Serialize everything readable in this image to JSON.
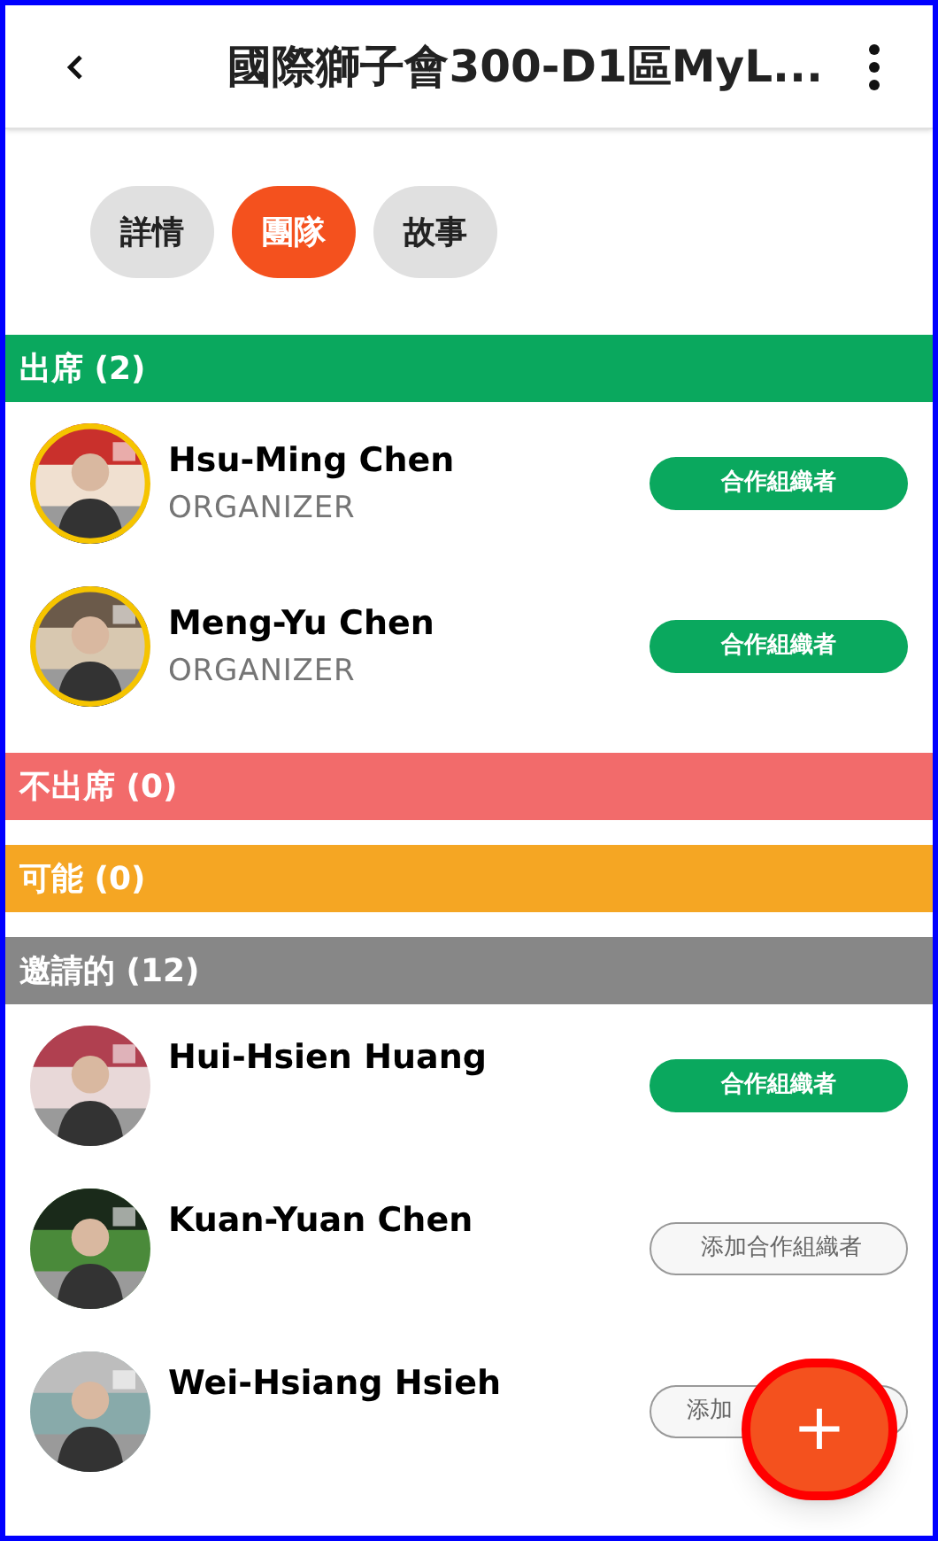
{
  "app_bar": {
    "title": "國際獅子會300-D1區MyL..."
  },
  "tabs": [
    {
      "label": "詳情",
      "selected": false
    },
    {
      "label": "團隊",
      "selected": true
    },
    {
      "label": "故事",
      "selected": false
    }
  ],
  "sections": [
    {
      "title": "出席 (2)",
      "color": "#0aa85e",
      "members": [
        {
          "name": "Hsu-Ming Chen",
          "role": "ORGANIZER",
          "ringed": true,
          "button": {
            "kind": "filled",
            "label": "合作組織者"
          }
        },
        {
          "name": "Meng-Yu Chen",
          "role": "ORGANIZER",
          "ringed": true,
          "button": {
            "kind": "filled",
            "label": "合作組織者"
          }
        }
      ]
    },
    {
      "title": "不出席 (0)",
      "color": "#f26b6b"
    },
    {
      "title": "可能 (0)",
      "color": "#f5a623"
    },
    {
      "title": "邀請的 (12)",
      "color": "#878787",
      "members": [
        {
          "name": "Hui-Hsien Huang",
          "ringed": false,
          "button": {
            "kind": "filled",
            "label": "合作組織者"
          }
        },
        {
          "name": "Kuan-Yuan Chen",
          "ringed": false,
          "button": {
            "kind": "outline",
            "label": "添加合作組織者"
          }
        },
        {
          "name": "Wei-Hsiang Hsieh",
          "ringed": false,
          "button": {
            "kind": "outline",
            "label": "添加",
            "partly_hidden": true
          }
        }
      ]
    }
  ],
  "fab": {
    "label": "+"
  }
}
